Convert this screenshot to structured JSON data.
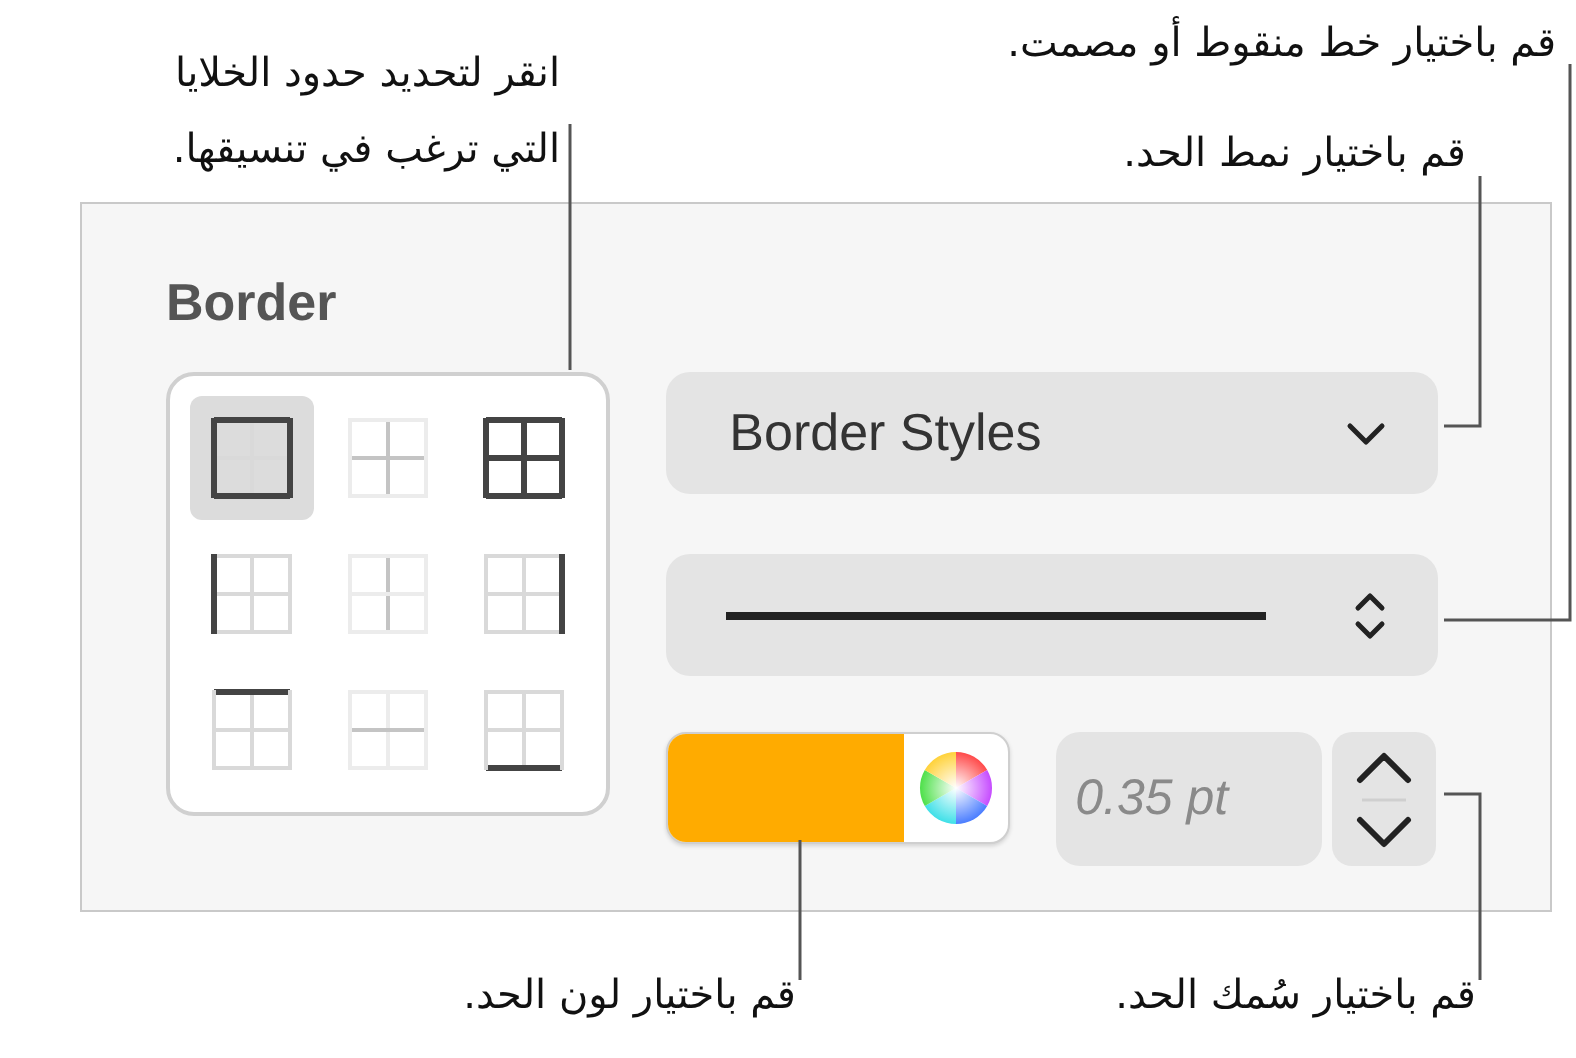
{
  "callouts": [
    {
      "kind": "cells",
      "lines": [
        "انقر لتحديد حدود الخلايا",
        "التي ترغب في تنسيقها."
      ]
    },
    {
      "kind": "line",
      "lines": [
        "قم باختيار خط منقوط أو مصمت."
      ]
    },
    {
      "kind": "style",
      "lines": [
        "قم باختيار نمط الحد."
      ]
    },
    {
      "kind": "width",
      "lines": [
        "قم باختيار سُمك الحد."
      ]
    },
    {
      "kind": "color",
      "lines": [
        "قم باختيار لون الحد."
      ]
    }
  ],
  "panel": {
    "title": "Border",
    "border_buttons": [
      {
        "kind": "outer",
        "selected": true
      },
      {
        "kind": "inner",
        "selected": false
      },
      {
        "kind": "all",
        "selected": false
      },
      {
        "kind": "left",
        "selected": false
      },
      {
        "kind": "vertical",
        "selected": false
      },
      {
        "kind": "right",
        "selected": false
      },
      {
        "kind": "top",
        "selected": false
      },
      {
        "kind": "horizontal",
        "selected": false
      },
      {
        "kind": "bottom",
        "selected": false
      }
    ],
    "style_menu": {
      "label": "Border Styles"
    },
    "line_menu": {
      "kind": "solid"
    },
    "color_well": {
      "color": "#ffab00"
    },
    "width_field": {
      "value": "0.35 pt"
    }
  }
}
